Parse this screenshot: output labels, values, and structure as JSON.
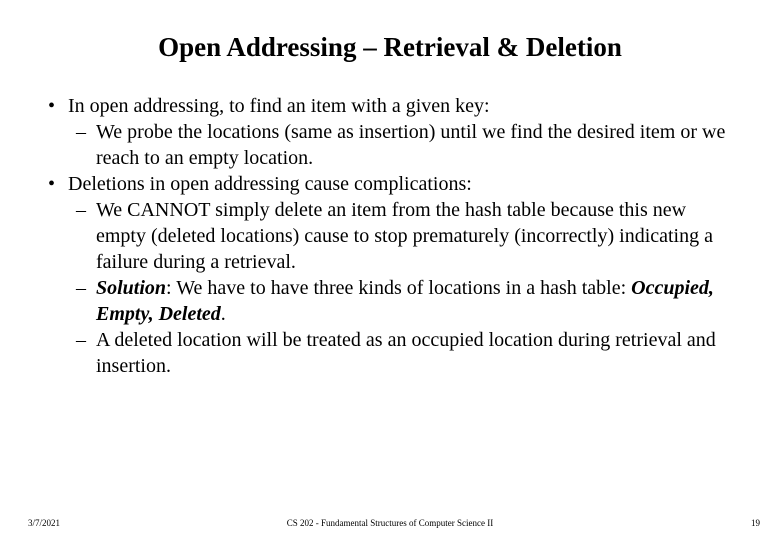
{
  "title": "Open Addressing – Retrieval & Deletion",
  "bullets": {
    "b1": "In open addressing, to find an item with a given key:",
    "b1a": "We probe the locations (same as insertion) until we find the desired item or we reach to an empty location.",
    "b2": "Deletions in open addressing cause complications:",
    "b2a": "We CANNOT simply delete an item from the hash table because this new empty (deleted locations) cause to stop prematurely (incorrectly) indicating a failure during a retrieval.",
    "b2b_label": "Solution",
    "b2b_text": ": We have to have three kinds of locations in a hash table: ",
    "b2b_states": "Occupied, Empty, Deleted",
    "b2b_end": ".",
    "b2c": "A deleted location will be treated as an occupied location during retrieval and insertion."
  },
  "footer": {
    "date": "3/7/2021",
    "course": "CS 202 - Fundamental Structures of Computer Science II",
    "page": "19"
  }
}
